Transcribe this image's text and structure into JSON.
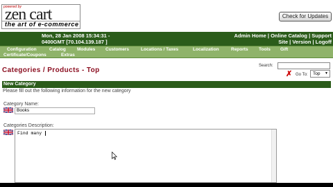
{
  "logo": {
    "powered_by": "powered by",
    "brand": "zen cart",
    "tagline": "the art of e-commerce"
  },
  "header": {
    "check_updates_label": "Check for Updates",
    "info_line1": "Mon, 28 Jan 2008 15:34:31 -",
    "info_line2": "0400GMT [70.104.139.187 ]",
    "links_line1": "Admin Home | Online Catalog | Support",
    "links_line2": "Site | Version | Logoff"
  },
  "menu": {
    "row1": [
      "Configuration",
      "Catalog",
      "Modules",
      "Customers",
      "Locations / Taxes",
      "Localization",
      "Reports",
      "Tools",
      "Gift"
    ],
    "row2": [
      "Certificate/Coupons",
      "Extras"
    ]
  },
  "page": {
    "title": "Categories / Products - Top",
    "search_label": "Search:",
    "goto_label": "Go To:",
    "goto_value": "Top"
  },
  "form": {
    "section_title": "New Category",
    "section_subtitle": "Please fill out the following information for the new category",
    "name_label": "Category Name:",
    "name_value": "Books",
    "desc_label": "Categories Description:",
    "desc_value": "Find many "
  },
  "colors": {
    "header_green": "#2b5c1a",
    "menu_green": "#8fb36a",
    "title_red": "#8b0e20"
  }
}
